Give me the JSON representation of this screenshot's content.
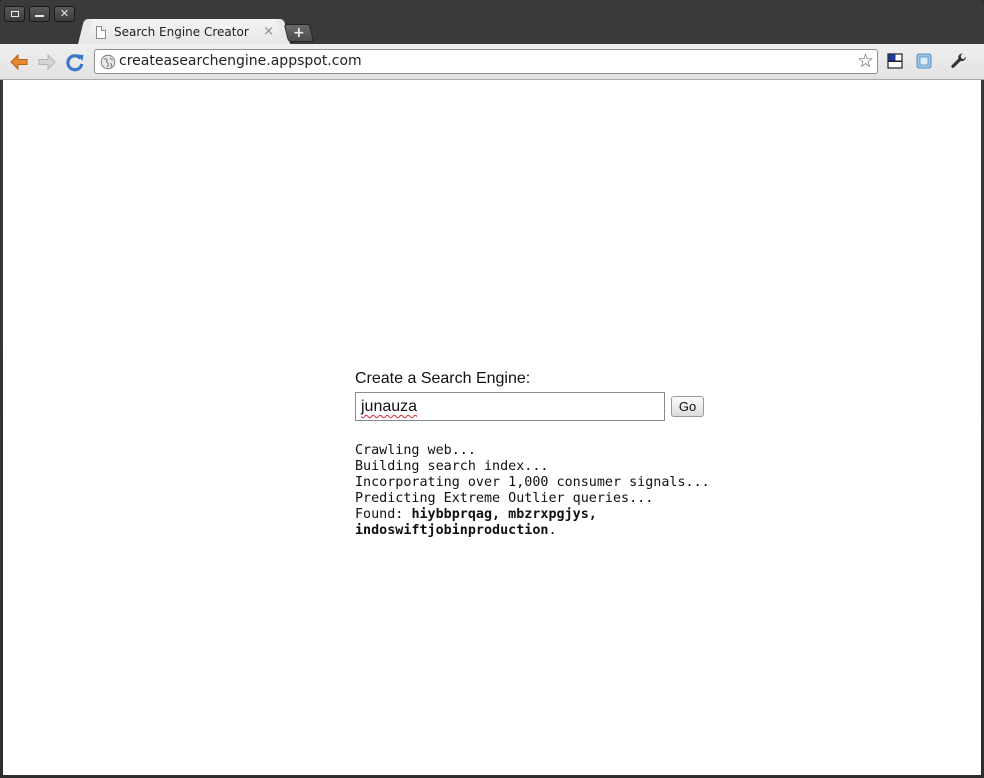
{
  "window": {
    "controls": [
      "maximize",
      "minimize",
      "close"
    ]
  },
  "tab": {
    "title": "Search Engine Creator",
    "close_glyph": "×",
    "new_tab_glyph": "+"
  },
  "toolbar": {
    "url": "createasearchengine.appspot.com",
    "icons": [
      "back-arrow-icon",
      "forward-arrow-icon",
      "reload-icon",
      "globe-icon",
      "star-icon",
      "extension-icon",
      "extension-icon",
      "wrench-icon"
    ]
  },
  "page": {
    "form_label": "Create a Search Engine:",
    "query_value": "junauza",
    "go_label": "Go",
    "log_lines": [
      "Crawling web...",
      "Building search index...",
      "Incorporating over 1,000 consumer signals...",
      "Predicting Extreme Outlier queries..."
    ],
    "found_prefix": "Found: ",
    "found_terms_line1": "hiybbprqag, mbzrxpgjys,",
    "found_terms_line2": "indoswiftjobinproduction",
    "found_suffix": "."
  },
  "colors": {
    "back_arrow": "#e8892f",
    "reload": "#3a78c9",
    "spellcheck_underline": "#d23333"
  }
}
